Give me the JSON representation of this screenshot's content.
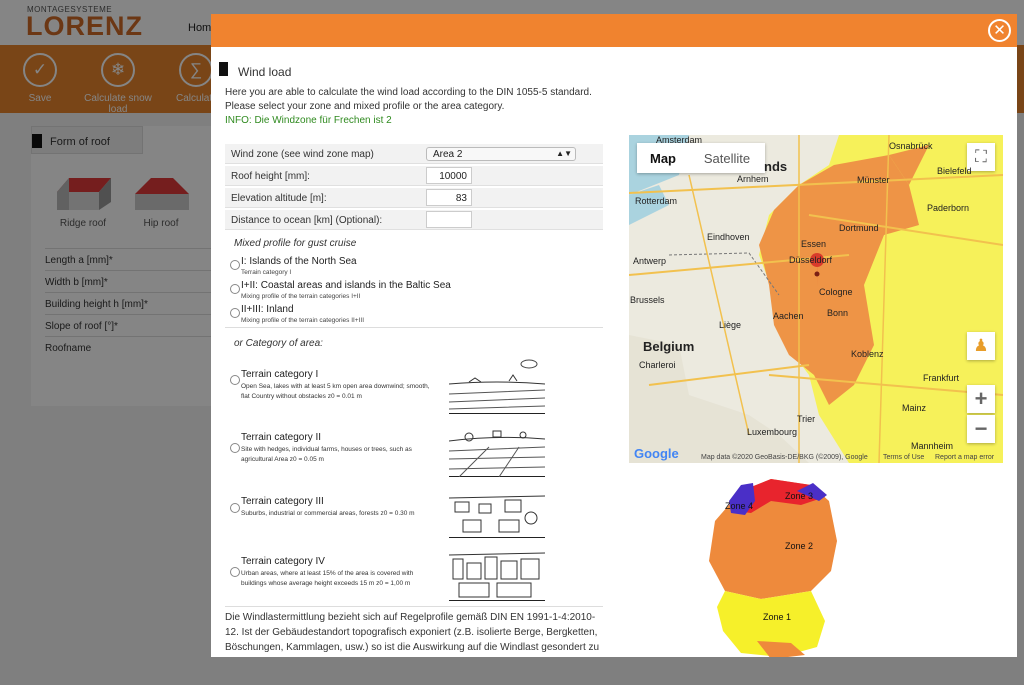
{
  "app": {
    "logo_small": "MONTAGESYSTEME",
    "logo_big": "LORENZ",
    "nav_home": "Home"
  },
  "toolbar": {
    "buttons": [
      {
        "label": "Save",
        "icon": "checkmark-icon"
      },
      {
        "label": "Calculate snow load",
        "icon": "snowflake-icon"
      },
      {
        "label": "Calculat",
        "icon": "calculate-icon"
      }
    ]
  },
  "roof_panel": {
    "tab": "Form of roof",
    "roofs": [
      "Ridge roof",
      "Hip roof"
    ],
    "fields": [
      "Length a [mm]*",
      "Width b [mm]*",
      "Building height h [mm]*",
      "Slope of roof [°]*",
      "Roofname"
    ]
  },
  "modal": {
    "title": "Wind load",
    "intro_line1": "Here you are able to calculate the wind load according to the DIN 1055-5 standard.",
    "intro_line2": "Please select your zone and mixed profile or the area category.",
    "info": "INFO: Die Windzone für Frechen ist 2",
    "form": {
      "wind_zone_label": "Wind zone (see wind zone map)",
      "wind_zone_value": "Area 2",
      "roof_height_label": "Roof height [mm]:",
      "roof_height_value": "10000",
      "elevation_label": "Elevation altitude [m]:",
      "elevation_value": "83",
      "distance_label": "Distance to ocean [km] (Optional):",
      "distance_value": ""
    },
    "mixed_profile": {
      "heading": "Mixed profile for gust cruise",
      "options": [
        {
          "title": "I: Islands of the North Sea",
          "sub": "Terrain category I"
        },
        {
          "title": "I+II: Coastal areas and islands in the Baltic Sea",
          "sub": "Mixing profile of the terrain categories I+II"
        },
        {
          "title": "II+III: Inland",
          "sub": "Mixing profile of the terrain categories II+III"
        }
      ]
    },
    "category": {
      "heading": "or Category of area:",
      "items": [
        {
          "title": "Terrain category I",
          "desc": "Open Sea, lakes with at least 5 km open area downwind; smooth, flat Country without obstacles z0 = 0.01 m"
        },
        {
          "title": "Terrain category II",
          "desc": "Site with hedges, individual farms, houses or trees, such as agricultural Area z0 = 0.05 m"
        },
        {
          "title": "Terrain category III",
          "desc": "Suburbs, industrial or commercial areas, forests z0 = 0.30 m"
        },
        {
          "title": "Terrain category IV",
          "desc": "Urban areas, where at least 15% of the area is covered with buildings whose average height exceeds 15 m z0 = 1,00 m"
        }
      ]
    },
    "bottom_text": "Die Windlastermittlung bezieht sich auf Regelprofile gemäß DIN EN 1991-1-4:2010-12. Ist der Gebäudestandort topografisch exponiert (z.B. isolierte Berge, Bergketten, Böschungen, Kammlagen, usw.) so ist die Auswirkung auf die Windlast gesondert zu erfassen. Kontaktieren Sie hierzu bitte einen Statiker."
  },
  "map": {
    "tab_map": "Map",
    "tab_satellite": "Satellite",
    "zoom_in": "+",
    "zoom_out": "−",
    "google": "Google",
    "attribution": "Map data ©2020 GeoBasis-DE/BKG (©2009), Google",
    "terms": "Terms of Use",
    "report": "Report a map error",
    "cities": [
      {
        "name": "Amsterdam",
        "cls": ""
      },
      {
        "name": "nds",
        "cls": "b"
      },
      {
        "name": "Osnabrück",
        "cls": ""
      },
      {
        "name": "Arnhem",
        "cls": ""
      },
      {
        "name": "Münster",
        "cls": ""
      },
      {
        "name": "Bielefeld",
        "cls": ""
      },
      {
        "name": "Rotterdam",
        "cls": ""
      },
      {
        "name": "Paderborn",
        "cls": ""
      },
      {
        "name": "Eindhoven",
        "cls": ""
      },
      {
        "name": "Dortmund",
        "cls": ""
      },
      {
        "name": "Antwerp",
        "cls": ""
      },
      {
        "name": "Essen",
        "cls": ""
      },
      {
        "name": "Düsseldorf",
        "cls": ""
      },
      {
        "name": "Brussels",
        "cls": ""
      },
      {
        "name": "Cologne",
        "cls": ""
      },
      {
        "name": "Aachen",
        "cls": ""
      },
      {
        "name": "Liège",
        "cls": ""
      },
      {
        "name": "Bonn",
        "cls": ""
      },
      {
        "name": "Belgium",
        "cls": "b"
      },
      {
        "name": "Charleroi",
        "cls": ""
      },
      {
        "name": "Koblenz",
        "cls": ""
      },
      {
        "name": "Frankfurt",
        "cls": ""
      },
      {
        "name": "Luxembourg",
        "cls": ""
      },
      {
        "name": "Mainz",
        "cls": ""
      },
      {
        "name": "Trier",
        "cls": ""
      },
      {
        "name": "Mannheim",
        "cls": ""
      }
    ]
  },
  "zone_map": {
    "zones": [
      "Zone 4",
      "Zone 3",
      "Zone 2",
      "Zone 1"
    ]
  },
  "colors": {
    "accent": "#f0832f",
    "info_green": "#2f8a1f",
    "zone_orange": "#ee8a3c",
    "zone_yellow": "#f6f02a",
    "zone_red": "#e8242d",
    "zone_blue": "#4a2fc7"
  }
}
